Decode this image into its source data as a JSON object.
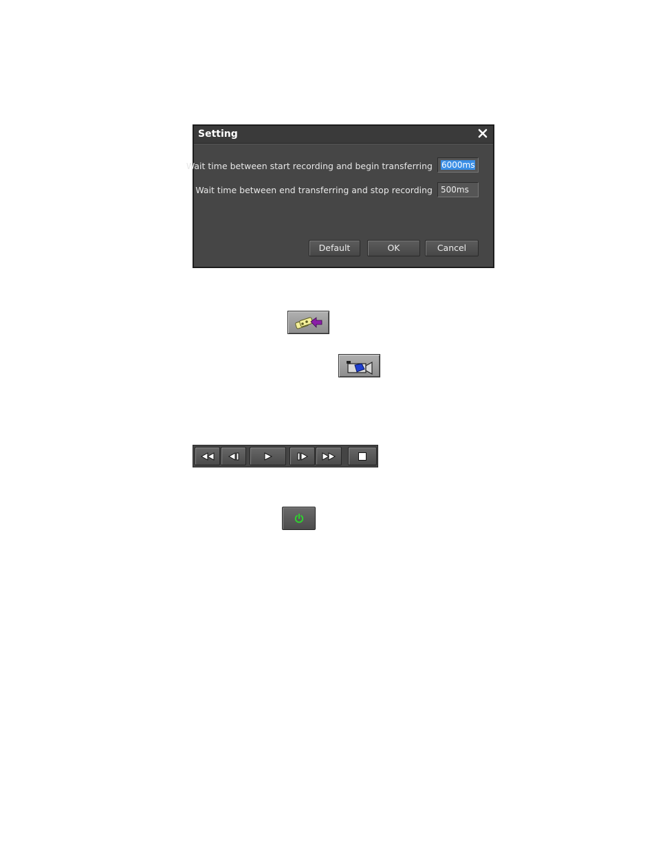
{
  "dialog": {
    "title": "Setting",
    "rows": [
      {
        "label": "Wait time between start recording and begin transferring",
        "value": "6000ms",
        "selected": true
      },
      {
        "label": "Wait time between end transferring and stop recording",
        "value": "500ms",
        "selected": false
      }
    ],
    "buttons": {
      "default": "Default",
      "ok": "OK",
      "cancel": "Cancel"
    }
  },
  "icons": {
    "close": "close-icon",
    "capture": "tape-capture-icon",
    "camera": "video-camera-icon",
    "rewind": "rewind-icon",
    "step_back": "step-back-icon",
    "play": "play-icon",
    "step_forward": "step-forward-icon",
    "fast_forward": "fast-forward-icon",
    "stop": "stop-icon",
    "power": "power-icon"
  },
  "colors": {
    "dialog_bg": "#464646",
    "selection": "#3a8ee6",
    "power_green": "#2fd12f",
    "capture_arrow": "#8b1fa8",
    "camera_blue": "#1f3fcf"
  }
}
